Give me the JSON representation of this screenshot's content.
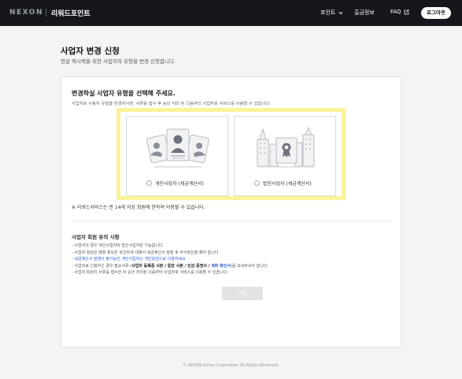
{
  "header": {
    "logo": "NEXON",
    "brand": "리워드포인트",
    "nav": {
      "points": "포인트",
      "attendance": "출금정보",
      "faq": "FAQ"
    },
    "login_label": "로그아웃"
  },
  "page": {
    "title": "사업자 변경 신청",
    "description": "현금 캐시백을 위한 사업자의 유형을 변경 신청합니다."
  },
  "form": {
    "heading": "변경하실 사업자 유형을 선택해 주세요.",
    "subtext": "사업자로 사용자 유형을 변경하시면, 서류를 접수 후 승인 처리 된 다음부터 사업자로 서비스를 이용할 수 있습니다.",
    "options": [
      {
        "label": "개인사업자 (세금계산서)",
        "icon": "personal-id-cards-illustration",
        "selected": false
      },
      {
        "label": "법인사업자 (세금계산서)",
        "icon": "corporate-building-illustration",
        "selected": false
      }
    ],
    "notice": "※ 리워드서비스는 만 14세 이상 회원에 한하여 이용할 수 있습니다.",
    "caution_title": "사업자 회원 유의 사항",
    "cautions": {
      "line1": "- 사업자의 경우 개인사업자와 법인사업자만 가능합니다.",
      "line2": "- 사업자 회원은 매월 획득한 포인트에 대해서 세금계산서 발행 후 수익정산을 해야 합니다",
      "line3": "- 세금계산서 발행이 불가능한 개인사업자는 개인회원으로 이용하세요",
      "line4_prefix": "- 사업자로 신청하신 경우 필요서류 (",
      "line4_bold": "사업자 등록증 사본 / 통장 사본 / 인감 증명서 / ",
      "line4_link": "계좌 확인서",
      "line4_suffix": ")를 보내주셔야 합니다.",
      "line5": "- 사업자 회원의 서류를 접수한 뒤 승인 처리된 다음부터 사업자로 서비스를 이용할 수 있습니다."
    },
    "next_label": "다음"
  },
  "footer": {
    "text": "© NEXON Korea Corporation All Rights Reserved."
  },
  "colors": {
    "topbar": "#15171c",
    "highlight": "#fbf39a",
    "link_blue": "#2f5fd1",
    "disabled_button": "#e3e3e5"
  }
}
